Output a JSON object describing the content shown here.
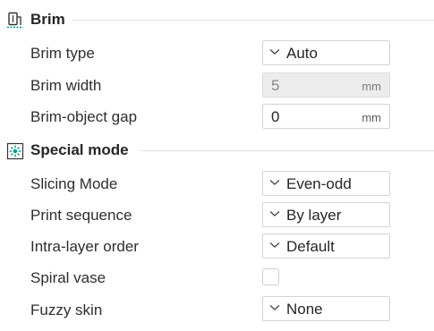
{
  "sections": {
    "brim": {
      "title": "Brim",
      "icon": "brim-icon",
      "brim_type": {
        "label": "Brim type",
        "value": "Auto"
      },
      "brim_width": {
        "label": "Brim width",
        "value": "5",
        "unit": "mm"
      },
      "brim_gap": {
        "label": "Brim-object gap",
        "value": "0",
        "unit": "mm"
      }
    },
    "special": {
      "title": "Special mode",
      "icon": "special-mode-icon",
      "slicing_mode": {
        "label": "Slicing Mode",
        "value": "Even-odd"
      },
      "print_sequence": {
        "label": "Print sequence",
        "value": "By layer"
      },
      "intra_layer_order": {
        "label": "Intra-layer order",
        "value": "Default"
      },
      "spiral_vase": {
        "label": "Spiral vase",
        "checked": false
      },
      "fuzzy_skin": {
        "label": "Fuzzy skin",
        "value": "None"
      }
    }
  },
  "colors": {
    "accent": "#009688",
    "divider": "#e0e0e0",
    "disabled_bg": "#ececec"
  }
}
